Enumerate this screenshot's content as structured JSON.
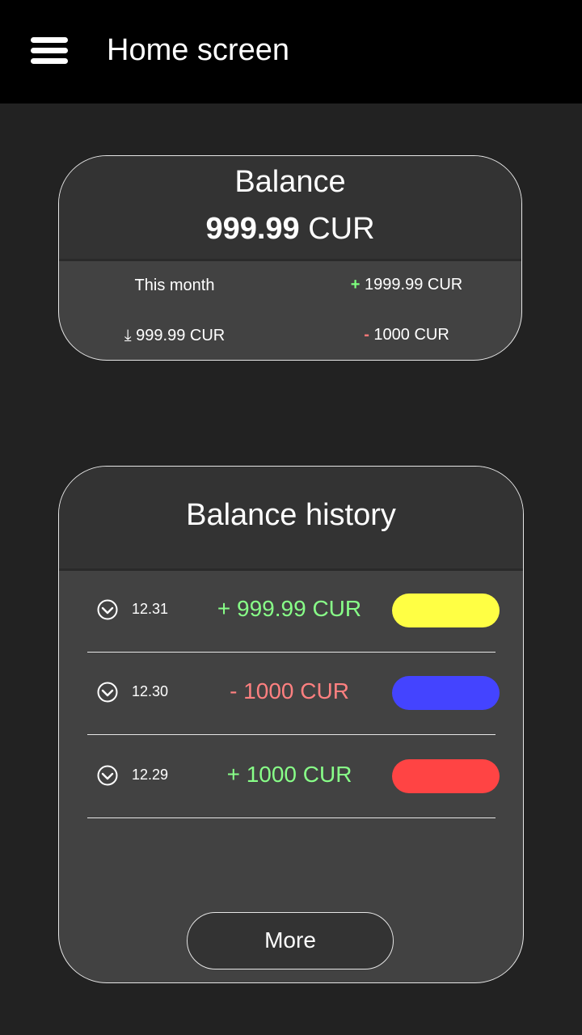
{
  "header": {
    "title": "Home screen",
    "menu_icon": "hamburger-menu-icon"
  },
  "balance": {
    "title": "Balance",
    "amount_value": "999.99",
    "amount_currency": "CUR",
    "this_month_label": "This month",
    "income_sign": "+",
    "income_value": "1999.99 CUR",
    "down_icon": "↓",
    "down_value": "999.99 CUR",
    "expense_sign": "-",
    "expense_value": "1000 CUR"
  },
  "history": {
    "title": "Balance history",
    "rows": [
      {
        "date": "12.31",
        "amount": "+ 999.99 CUR",
        "direction": "positive",
        "tag_color": "#ffff44"
      },
      {
        "date": "12.30",
        "amount": "- 1000 CUR",
        "direction": "negative",
        "tag_color": "#4444ff"
      },
      {
        "date": "12.29",
        "amount": "+ 1000 CUR",
        "direction": "positive",
        "tag_color": "#ff4444"
      }
    ],
    "more_label": "More"
  },
  "colors": {
    "positive": "#88ff88",
    "negative": "#ff8080",
    "background": "#222222",
    "card": "#424242"
  }
}
